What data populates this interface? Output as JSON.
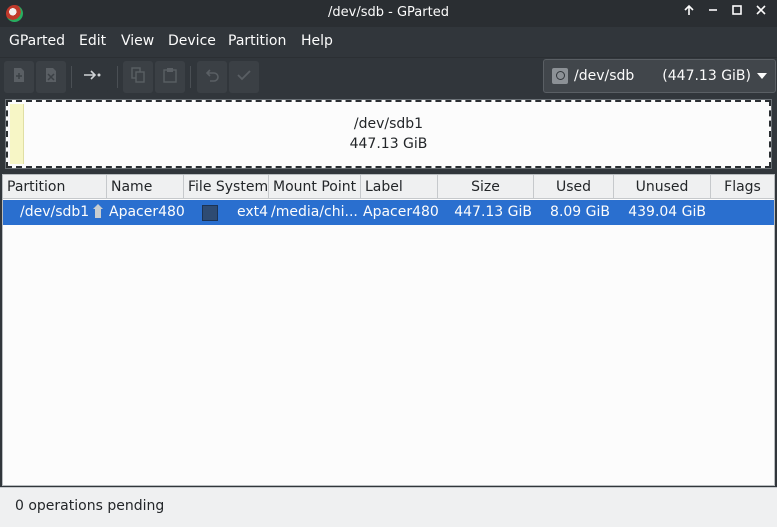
{
  "window": {
    "title": "/dev/sdb - GParted",
    "controls": [
      "restore-icon",
      "minimize-icon",
      "maximize-icon",
      "close-icon"
    ]
  },
  "menubar": {
    "items": [
      {
        "label": "GParted"
      },
      {
        "label": "Edit"
      },
      {
        "label": "View"
      },
      {
        "label": "Device"
      },
      {
        "label": "Partition"
      },
      {
        "label": "Help"
      }
    ]
  },
  "toolbar": {
    "buttons": [
      {
        "icon": "new-partition-icon",
        "enabled": false
      },
      {
        "icon": "delete-partition-icon",
        "enabled": false
      },
      {
        "icon": "resize-move-icon",
        "enabled": true
      },
      {
        "icon": "copy-icon",
        "enabled": false
      },
      {
        "icon": "paste-icon",
        "enabled": false
      },
      {
        "icon": "undo-icon",
        "enabled": false
      },
      {
        "icon": "apply-icon",
        "enabled": false
      }
    ]
  },
  "device_selector": {
    "device": "/dev/sdb",
    "size": "(447.13 GiB)"
  },
  "disk_graph": {
    "partition": "/dev/sdb1",
    "size": "447.13 GiB",
    "used_fraction": 0.018
  },
  "table": {
    "columns": [
      "Partition",
      "Name",
      "File System",
      "Mount Point",
      "Label",
      "Size",
      "Used",
      "Unused",
      "Flags"
    ],
    "rows": [
      {
        "partition": "/dev/sdb1",
        "name": "Apacer480",
        "filesystem": "ext4",
        "mount_point": "/media/chi...",
        "label": "Apacer480",
        "size": "447.13 GiB",
        "used": "8.09 GiB",
        "unused": "439.04 GiB",
        "flags": ""
      }
    ]
  },
  "status": {
    "text": "0 operations pending"
  },
  "colors": {
    "selection": "#2a6fcf",
    "ext4": "#2e4b73",
    "used_space": "#f7f6c6"
  }
}
